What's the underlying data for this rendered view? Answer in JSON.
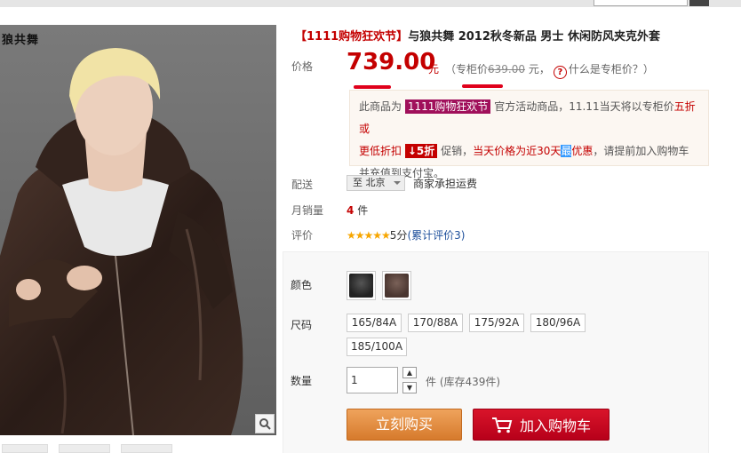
{
  "topnav": {
    "brand": "",
    "items": [],
    "search_placeholder": ""
  },
  "product": {
    "image_logo": "狼共舞",
    "title_tag": "【1111购物狂欢节】",
    "title_text": "与狼共舞 2012秋冬新品 男士 休闲防风夹克外套"
  },
  "price": {
    "label": "价格",
    "value": "739.00",
    "unit": "元",
    "ref_prefix": "（专柜价",
    "ref_value": "639.00",
    "ref_suffix": " 元，",
    "help_icon": "?",
    "help_text": "什么是专柜价？）"
  },
  "promo": {
    "p1": "此商品为",
    "badge": "1111购物狂欢节",
    "p2": "官方活动商品，11.11当天将以专柜价",
    "r1": "五折或",
    "r2": "更低折扣",
    "disc": "↓5折",
    "p3": "促销，",
    "r3": "当天价格为近30天",
    "sel": "最",
    "r4": "优惠",
    "p4": "，请提前加入购物车并充值到支付宝。"
  },
  "shipping": {
    "label": "配送",
    "destination": "至 北京",
    "note": "商家承担运费"
  },
  "sales": {
    "label": "月销量",
    "count": "4",
    "unit": "件"
  },
  "rating": {
    "label": "评价",
    "stars": "★★★★★",
    "score": "5分",
    "link": "(累计评价3)"
  },
  "options": {
    "color_label": "颜色",
    "size_label": "尺码",
    "sizes": [
      "165/84A",
      "170/88A",
      "175/92A",
      "180/96A",
      "185/100A"
    ],
    "qty_label": "数量",
    "qty_value": "1",
    "stock": "件 (库存439件)",
    "buy_label": "立刻购买",
    "cart_label": "加入购物车"
  },
  "colors": {
    "accent_red": "#c40000",
    "promo_badge": "#a0105b",
    "buy_button": "#e08e44",
    "cart_button": "#c8001e"
  }
}
